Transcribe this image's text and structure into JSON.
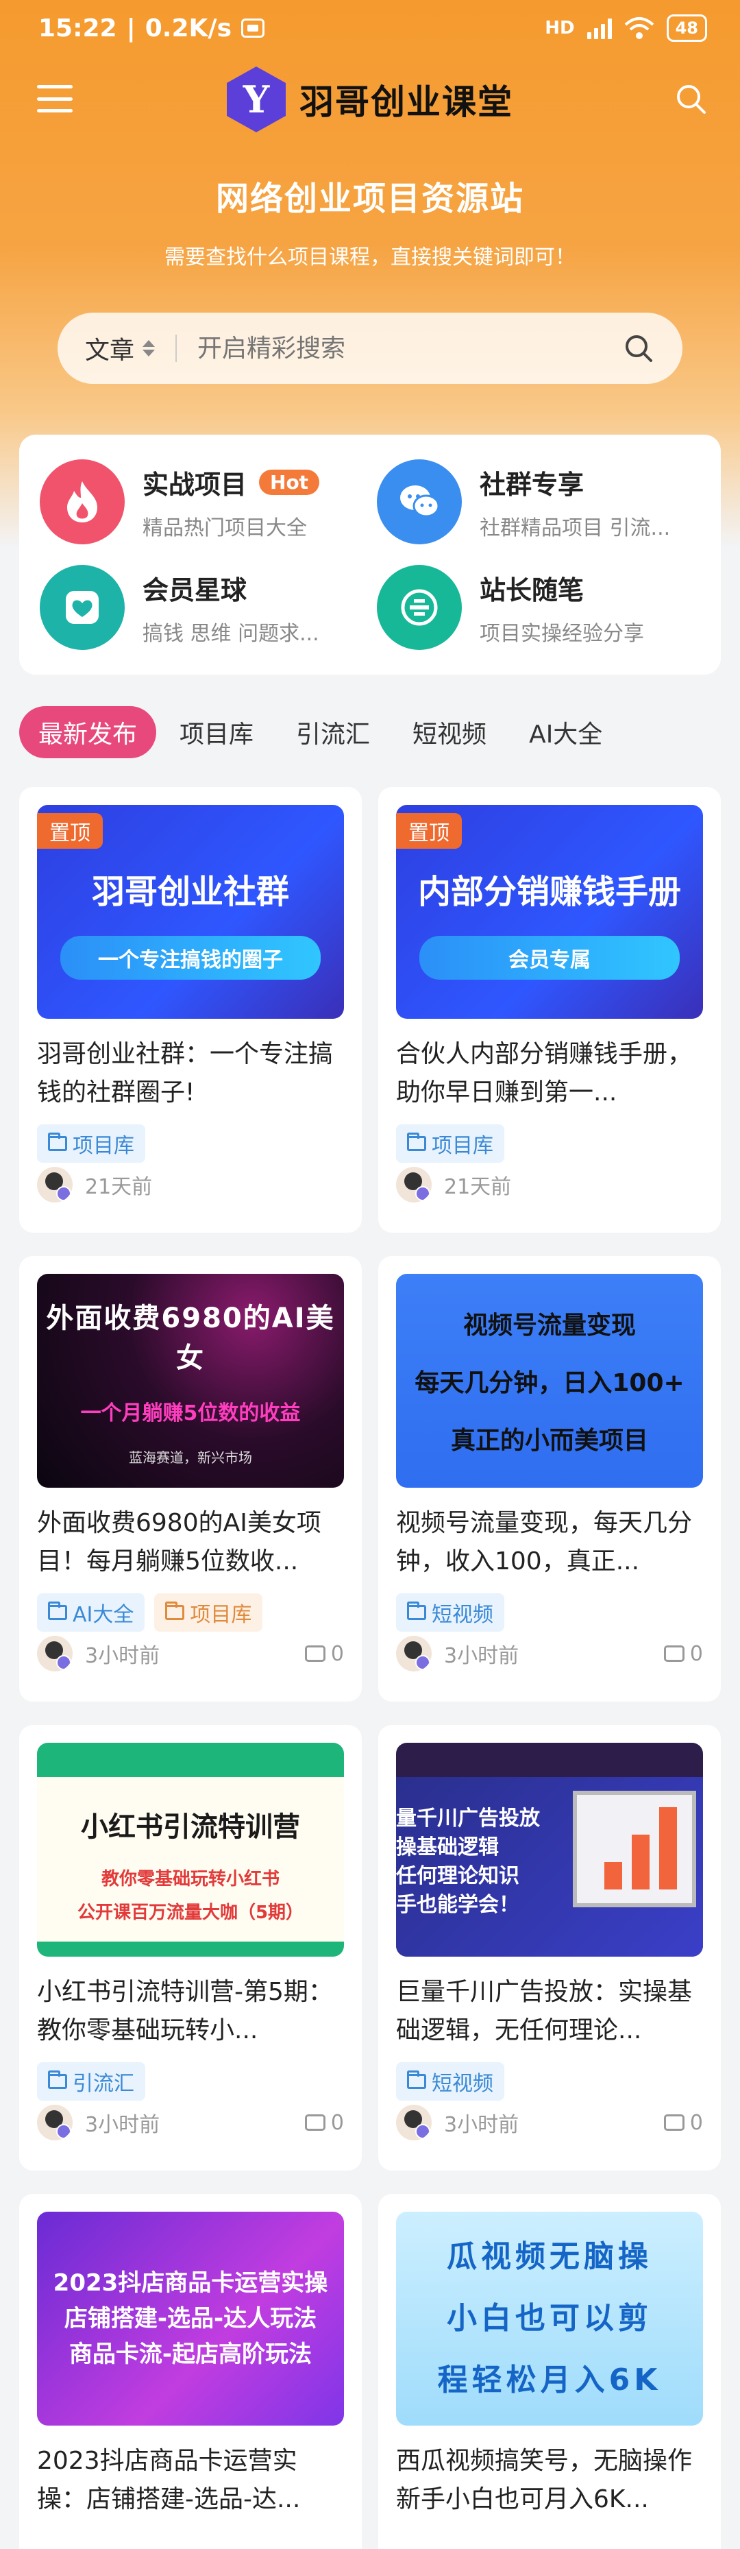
{
  "status_bar": {
    "time": "15:22",
    "speed": "0.2K/s",
    "network": "HD",
    "battery": "48"
  },
  "header": {
    "logo_letter": "Y",
    "site_name": "羽哥创业课堂",
    "hero_title": "网络创业项目资源站",
    "hero_subtitle": "需要查找什么项目课程，直接搜关键词即可！"
  },
  "search": {
    "type": "文章",
    "placeholder": "开启精彩搜索"
  },
  "features": [
    {
      "title": "实战项目",
      "badge": "Hot",
      "desc": "精品热门项目大全",
      "icon": "flame-icon",
      "color": "#f0536b"
    },
    {
      "title": "社群专享",
      "badge": "",
      "desc": "社群精品项目 引流...",
      "icon": "chat-icon",
      "color": "#3a8ef0"
    },
    {
      "title": "会员星球",
      "badge": "",
      "desc": "搞钱 思维 问题求...",
      "icon": "heart-icon",
      "color": "#1eb3a8"
    },
    {
      "title": "站长随笔",
      "badge": "",
      "desc": "项目实操经验分享",
      "icon": "pen-icon",
      "color": "#17b897"
    }
  ],
  "tabs": [
    "最新发布",
    "项目库",
    "引流汇",
    "短视频",
    "AI大全"
  ],
  "posts": [
    {
      "pinned": "置顶",
      "thumb_lines": [
        "羽哥创业社群",
        "一个专注搞钱的圈子"
      ],
      "title": "羽哥创业社群：一个专注搞钱的社群圈子!",
      "tags": [
        {
          "label": "项目库",
          "style": "blue"
        }
      ],
      "time": "21天前",
      "comments": ""
    },
    {
      "pinned": "置顶",
      "thumb_lines": [
        "内部分销赚钱手册",
        "会员专属"
      ],
      "title": "合伙人内部分销赚钱手册，助你早日赚到第一...",
      "tags": [
        {
          "label": "项目库",
          "style": "blue"
        }
      ],
      "time": "21天前",
      "comments": ""
    },
    {
      "pinned": "",
      "thumb_lines": [
        "外面收费6980的AI美女",
        "一个月躺赚5位数的收益",
        "蓝海赛道，新兴市场"
      ],
      "title": "外面收费6980的AI美女项目！每月躺赚5位数收...",
      "tags": [
        {
          "label": "AI大全",
          "style": "blue"
        },
        {
          "label": "项目库",
          "style": "orange"
        }
      ],
      "time": "3小时前",
      "comments": "0"
    },
    {
      "pinned": "",
      "thumb_lines": [
        "视频号流量变现",
        "每天几分钟，日入100+",
        "真正的小而美项目"
      ],
      "title": "视频号流量变现，每天几分钟，收入100，真正...",
      "tags": [
        {
          "label": "短视频",
          "style": "blue"
        }
      ],
      "time": "3小时前",
      "comments": "0"
    },
    {
      "pinned": "",
      "thumb_lines": [
        "小红书引流特训营",
        "教你零基础玩转小红书",
        "公开课百万流量大咖（5期）"
      ],
      "title": "小红书引流特训营-第5期：教你零基础玩转小...",
      "tags": [
        {
          "label": "引流汇",
          "style": "blue"
        }
      ],
      "time": "3小时前",
      "comments": "0"
    },
    {
      "pinned": "",
      "thumb_lines": [
        "量千川广告投放",
        "操基础逻辑",
        "任何理论知识",
        "手也能学会！"
      ],
      "title": "巨量千川广告投放：实操基础逻辑，无任何理论...",
      "tags": [
        {
          "label": "短视频",
          "style": "blue"
        }
      ],
      "time": "3小时前",
      "comments": "0"
    },
    {
      "pinned": "",
      "thumb_lines": [
        "2023抖店商品卡运营实操",
        "店铺搭建-选品-达人玩法",
        "商品卡流-起店高阶玩法"
      ],
      "title": "2023抖店商品卡运营实操：店铺搭建-选品-达...",
      "tags": [],
      "time": "",
      "comments": ""
    },
    {
      "pinned": "",
      "thumb_lines": [
        "瓜视频无脑操",
        "小白也可以剪",
        "程轻松月入6K"
      ],
      "title": "西瓜视频搞笑号，无脑操作新手小白也可月入6K...",
      "tags": [],
      "time": "",
      "comments": ""
    }
  ]
}
